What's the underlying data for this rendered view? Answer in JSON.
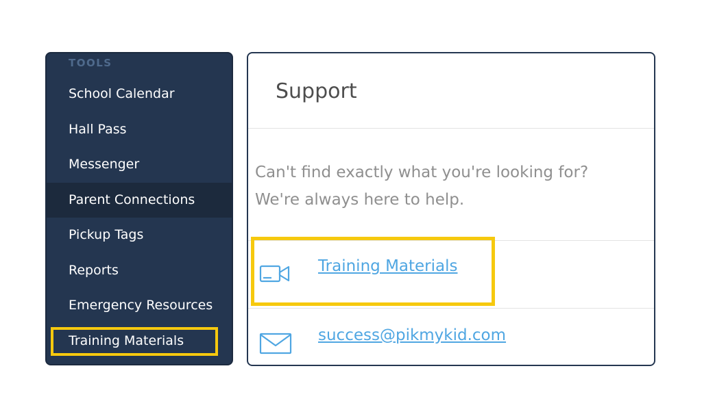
{
  "sidebar": {
    "section_heading": "TOOLS",
    "items": [
      {
        "label": "School Calendar",
        "active": false,
        "highlighted": false
      },
      {
        "label": "Hall Pass",
        "active": false,
        "highlighted": false
      },
      {
        "label": "Messenger",
        "active": false,
        "highlighted": false
      },
      {
        "label": "Parent Connections",
        "active": true,
        "highlighted": false
      },
      {
        "label": "Pickup Tags",
        "active": false,
        "highlighted": false
      },
      {
        "label": "Reports",
        "active": false,
        "highlighted": false
      },
      {
        "label": "Emergency Resources",
        "active": false,
        "highlighted": false
      },
      {
        "label": "Training Materials",
        "active": false,
        "highlighted": true
      }
    ]
  },
  "support": {
    "title": "Support",
    "intro_line1": "Can't find exactly what you're looking for?",
    "intro_line2": "We're always here to help.",
    "links": [
      {
        "icon": "video-camera-icon",
        "label": "Training Materials"
      },
      {
        "icon": "envelope-icon",
        "label": "success@pikmykid.com"
      }
    ]
  },
  "colors": {
    "sidebar_bg": "#243650",
    "sidebar_active_bg": "#1c2a3d",
    "highlight": "#f6c90e",
    "link": "#4fa6e2",
    "icon": "#4fa6e2"
  }
}
